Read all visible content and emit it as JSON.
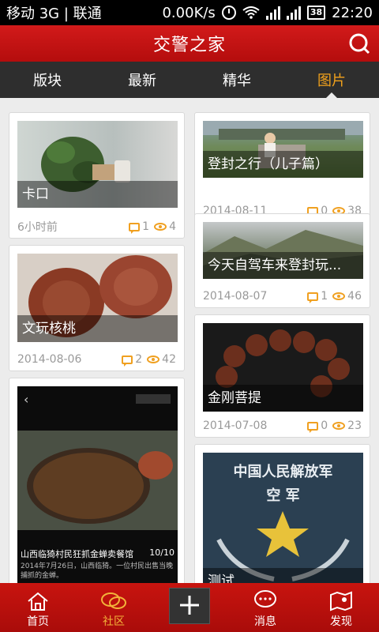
{
  "status_bar": {
    "carrier": "移动 3G | 联通",
    "speed": "0.00K/s",
    "battery": "38",
    "time": "22:20"
  },
  "header": {
    "title": "交警之家"
  },
  "tabs": [
    {
      "label": "版块"
    },
    {
      "label": "最新"
    },
    {
      "label": "精华"
    },
    {
      "label": "图片"
    }
  ],
  "cards": [
    {
      "caption": "卡口",
      "date": "6小时前",
      "comments": "1",
      "views": "4"
    },
    {
      "caption": "登封之行（儿子篇）",
      "date": "2014-08-11",
      "comments": "0",
      "views": "38"
    },
    {
      "caption": "文玩核桃",
      "date": "2014-08-06",
      "comments": "2",
      "views": "42"
    },
    {
      "caption": "今天自驾车来登封玩...",
      "date": "2014-08-07",
      "comments": "1",
      "views": "46"
    },
    {
      "caption": "金刚菩提",
      "date": "2014-07-08",
      "comments": "0",
      "views": "23"
    },
    {
      "caption": "",
      "date": "",
      "comments": "",
      "views": "",
      "overlay_text": "山西临猗村民狂抓金蝉卖餐馆",
      "overlay_counter": "10/10",
      "overlay_sub": "2014年7月26日，山西临猗。一位村民出售当晚捕抓的金蝉。"
    },
    {
      "caption": "测试",
      "date": "",
      "comments": "",
      "views": "",
      "badge_text": "中国人民解放军",
      "badge_sub": "空 军"
    }
  ],
  "bottom_nav": [
    {
      "label": "首页"
    },
    {
      "label": "社区"
    },
    {
      "label": ""
    },
    {
      "label": "消息"
    },
    {
      "label": "发现"
    }
  ],
  "colors": {
    "primary_red": "#c8140f",
    "accent_orange": "#f2a21c"
  }
}
